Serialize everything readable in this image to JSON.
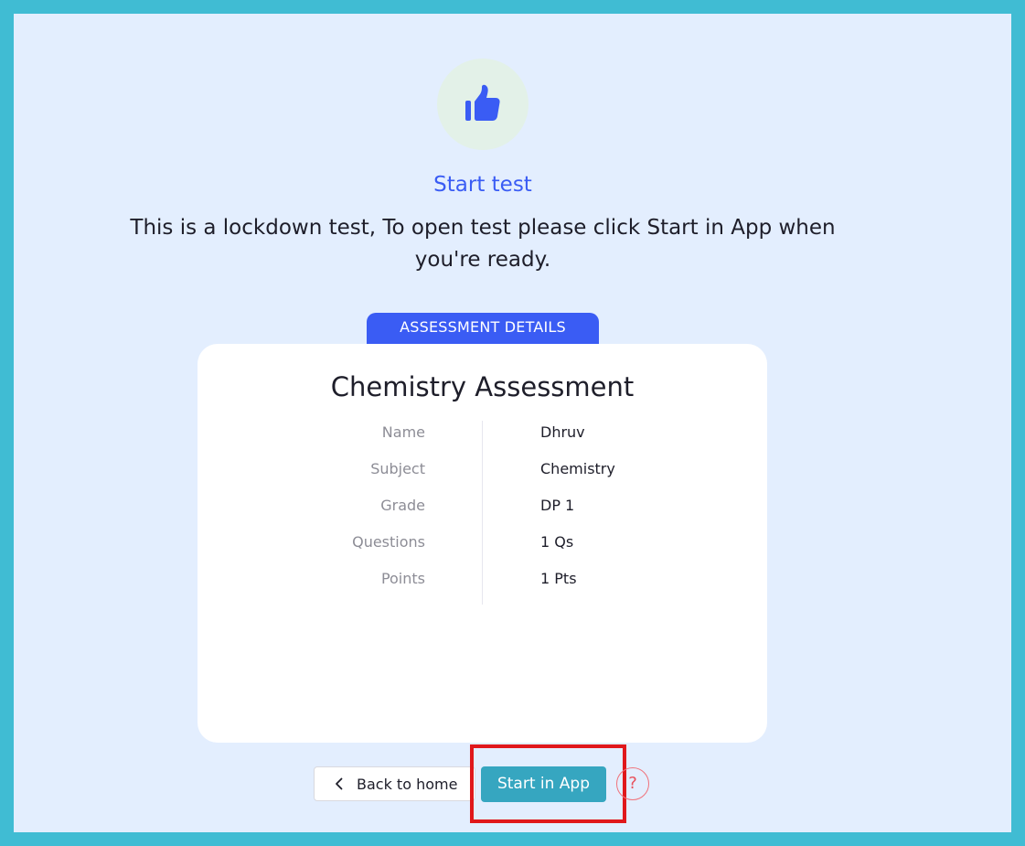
{
  "header": {
    "title": "Start test",
    "message": "This is a lockdown test, To open test please click Start in App when you're ready."
  },
  "tab_label": "ASSESSMENT DETAILS",
  "assessment": {
    "title": "Chemistry Assessment",
    "details": [
      {
        "label": "Name",
        "value": "Dhruv"
      },
      {
        "label": "Subject",
        "value": "Chemistry"
      },
      {
        "label": "Grade",
        "value": "DP 1"
      },
      {
        "label": "Questions",
        "value": "1 Qs"
      },
      {
        "label": "Points",
        "value": "1 Pts"
      }
    ]
  },
  "actions": {
    "back_label": "Back to home",
    "start_label": "Start in App",
    "help_label": "?"
  },
  "icons": {
    "hero": "thumbs-up-icon",
    "back": "chevron-left-icon",
    "help": "question-mark-icon"
  },
  "colors": {
    "frame": "#40bcd3",
    "background": "#e3eefe",
    "accent": "#3a5cf4",
    "start_button": "#36a6c0",
    "highlight": "#e0181b"
  }
}
